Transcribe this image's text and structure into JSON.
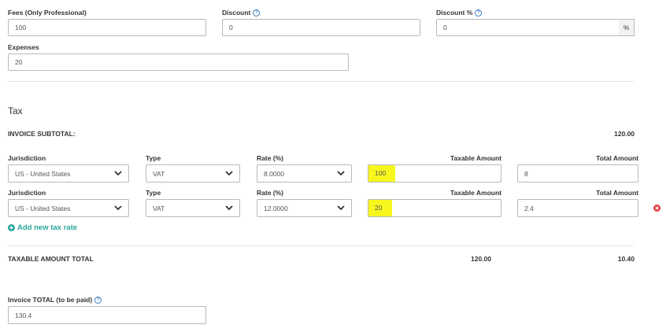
{
  "fees": {
    "label": "Fees (Only Professional)",
    "value": "100"
  },
  "discount": {
    "label": "Discount",
    "value": "0"
  },
  "discount_pct": {
    "label": "Discount %",
    "value": "0",
    "suffix": "%"
  },
  "expenses": {
    "label": "Expenses",
    "value": "20"
  },
  "tax": {
    "heading": "Tax",
    "subtotal_label": "INVOICE SUBTOTAL:",
    "subtotal_value": "120.00",
    "column_labels": {
      "jurisdiction": "Jurisdiction",
      "type": "Type",
      "rate": "Rate (%)",
      "taxable": "Taxable Amount",
      "total": "Total Amount"
    },
    "rows": [
      {
        "jurisdiction": "US - United States",
        "type": "VAT",
        "rate": "8.0000",
        "taxable": "100",
        "total": "8"
      },
      {
        "jurisdiction": "US - United States",
        "type": "VAT",
        "rate": "12.0000",
        "taxable": "20",
        "total": "2.4"
      }
    ],
    "add_label": "Add new tax rate",
    "taxable_total_label": "TAXABLE AMOUNT TOTAL",
    "taxable_total_value": "120.00",
    "tax_total_value": "10.40"
  },
  "invoice_total": {
    "label": "Invoice TOTAL (to be paid)",
    "value": "130.4"
  },
  "colors": {
    "accent": "#26a69a",
    "highlight": "#f7f71e",
    "remove": "#e53935",
    "help": "#3a7bbf"
  }
}
